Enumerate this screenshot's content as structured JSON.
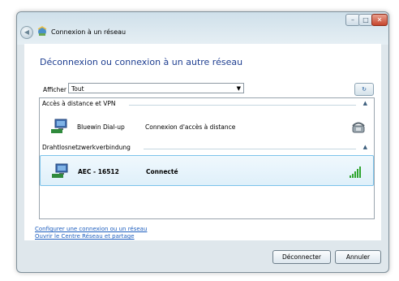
{
  "window": {
    "title": "Connexion à un réseau"
  },
  "main": {
    "heading": "Déconnexion ou connexion à un autre réseau",
    "filter": {
      "label": "Afficher :",
      "value": "Tout"
    }
  },
  "groups": [
    {
      "label": "Accès à distance et VPN",
      "networks": [
        {
          "name": "Bluewin Dial-up",
          "status": "Connexion d'accès à distance",
          "icon": "modem-phone-icon"
        }
      ]
    },
    {
      "label": "Drahtlosnetzwerkverbindung",
      "networks": [
        {
          "name": "AEC - 16512",
          "status": "Connecté",
          "icon": "signal-strength-icon",
          "selected": true
        }
      ]
    }
  ],
  "links": [
    "Configurer une connexion ou un réseau",
    "Ouvrir le Centre Réseau et partage"
  ],
  "buttons": {
    "disconnect": "Déconnecter",
    "cancel": "Annuler"
  },
  "colors": {
    "heading": "#1f3f91",
    "link": "#1f5fbf",
    "selection_border": "#7cc3ea",
    "signal": "#2fa52f"
  }
}
